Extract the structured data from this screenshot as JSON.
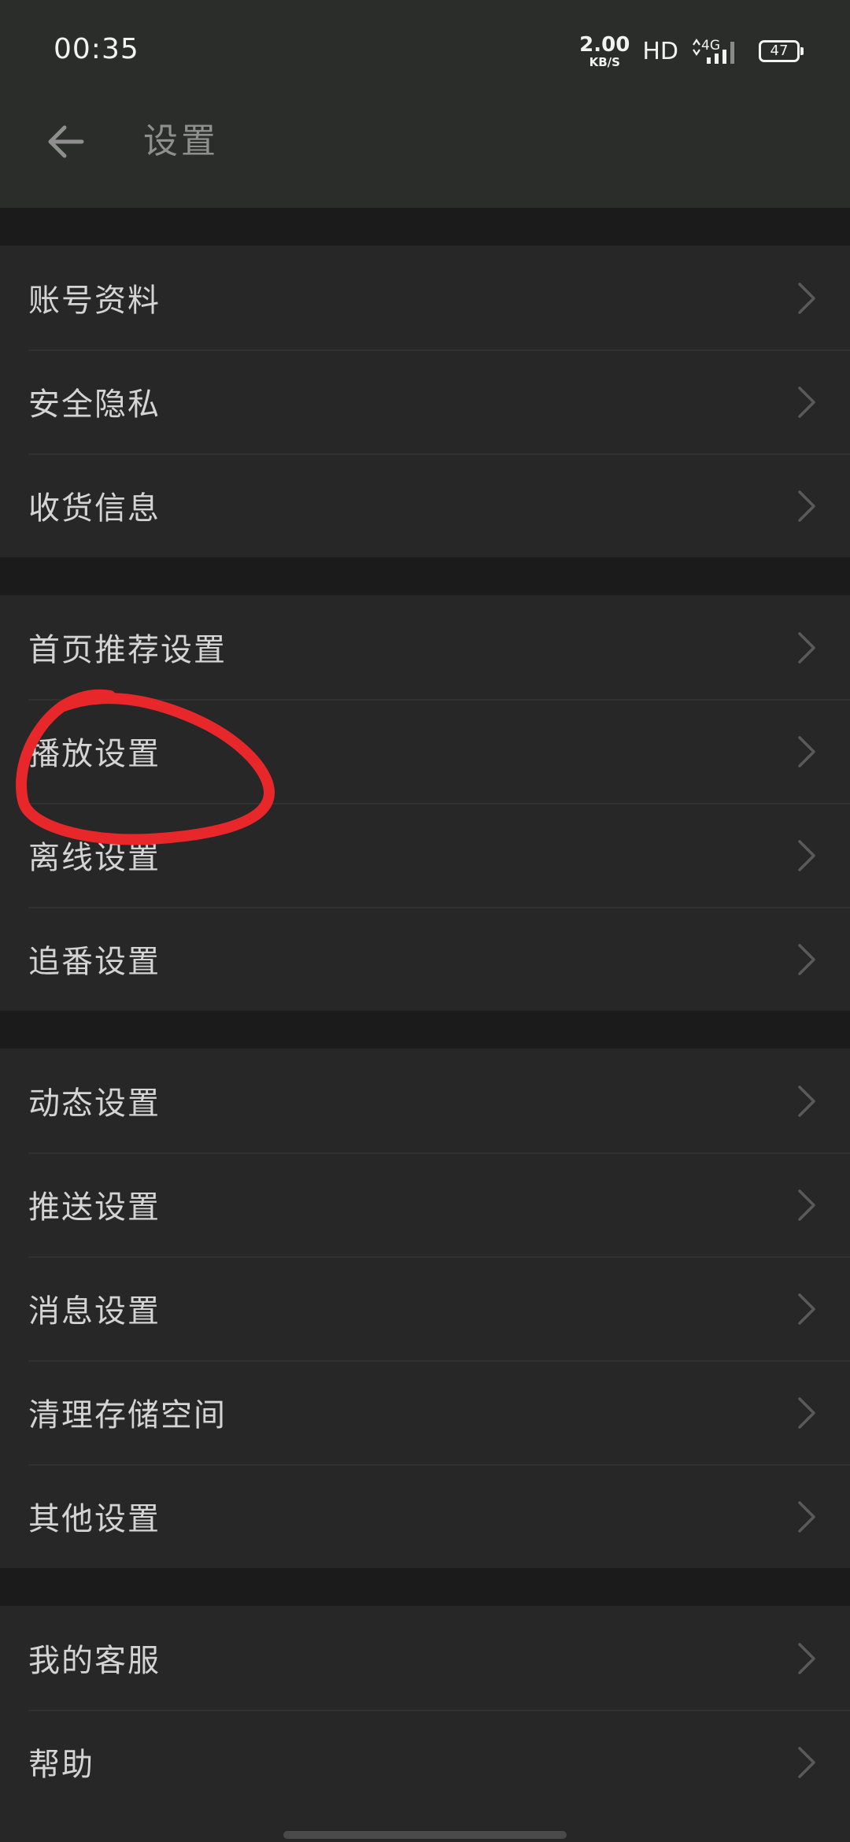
{
  "status_bar": {
    "time": "00:35",
    "net_speed": "2.00",
    "net_unit": "KB/S",
    "hd": "HD",
    "network": "4G",
    "battery": "47"
  },
  "header": {
    "title": "设置"
  },
  "groups": [
    {
      "items": [
        {
          "label": "账号资料"
        },
        {
          "label": "安全隐私"
        },
        {
          "label": "收货信息"
        }
      ]
    },
    {
      "items": [
        {
          "label": "首页推荐设置"
        },
        {
          "label": "播放设置"
        },
        {
          "label": "离线设置"
        },
        {
          "label": "追番设置"
        }
      ]
    },
    {
      "items": [
        {
          "label": "动态设置"
        },
        {
          "label": "推送设置"
        },
        {
          "label": "消息设置"
        },
        {
          "label": "清理存储空间"
        },
        {
          "label": "其他设置"
        }
      ]
    },
    {
      "items": [
        {
          "label": "我的客服"
        },
        {
          "label": "帮助"
        }
      ]
    }
  ],
  "colors": {
    "header_bg": "#2b2d2b",
    "list_bg": "#272727",
    "page_bg": "#1b1b1b",
    "annotation": "#e8272a"
  },
  "icons": {
    "back": "arrow-left-icon",
    "row_chevron": "chevron-right-icon"
  }
}
